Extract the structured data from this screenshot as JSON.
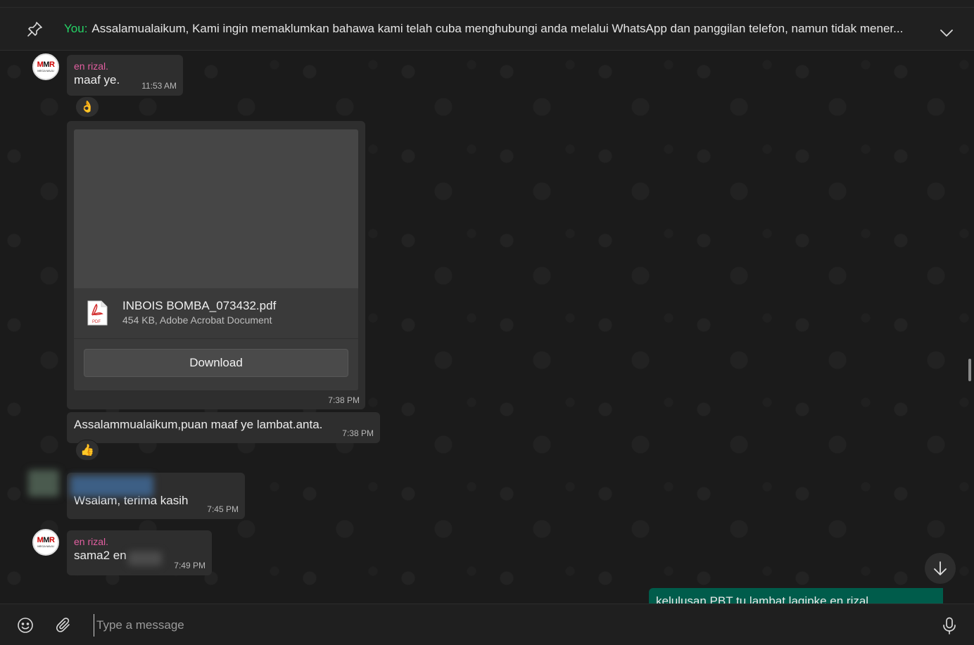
{
  "pinned": {
    "you_label": "You:",
    "text": "Assalamualaikum,  Kami ingin memaklumkan bahawa kami telah cuba menghubungi anda melalui WhatsApp dan panggilan telefon, namun tidak mener..."
  },
  "avatar": {
    "logo_a": "M",
    "logo_b": "M",
    "logo_c": "R",
    "sub": "MEGA MAJU"
  },
  "messages": [
    {
      "sender": "en rizal.",
      "text": "maaf ye.",
      "time": "11:53 AM",
      "reaction": "👌"
    },
    {
      "doc_name": "INBOIS BOMBA_073432.pdf",
      "doc_meta": "454 KB, Adobe Acrobat Document",
      "download_label": "Download",
      "time": "7:38 PM"
    },
    {
      "text": "Assalammualaikum,puan maaf ye lambat.anta.",
      "time": "7:38 PM",
      "reaction": "👍"
    },
    {
      "text": "Wsalam, terima kasih",
      "time": "7:45 PM"
    },
    {
      "sender": "en rizal.",
      "text": "sama2 en",
      "time": "7:49 PM"
    },
    {
      "text": "kelulusan PBT tu lambat lagipke en rizal"
    }
  ],
  "pdf_label": "PDF",
  "composer": {
    "placeholder": "Type a message"
  },
  "colors": {
    "accent": "#25d366",
    "sender": "#e15fa0",
    "outgoing": "#005c4b"
  }
}
